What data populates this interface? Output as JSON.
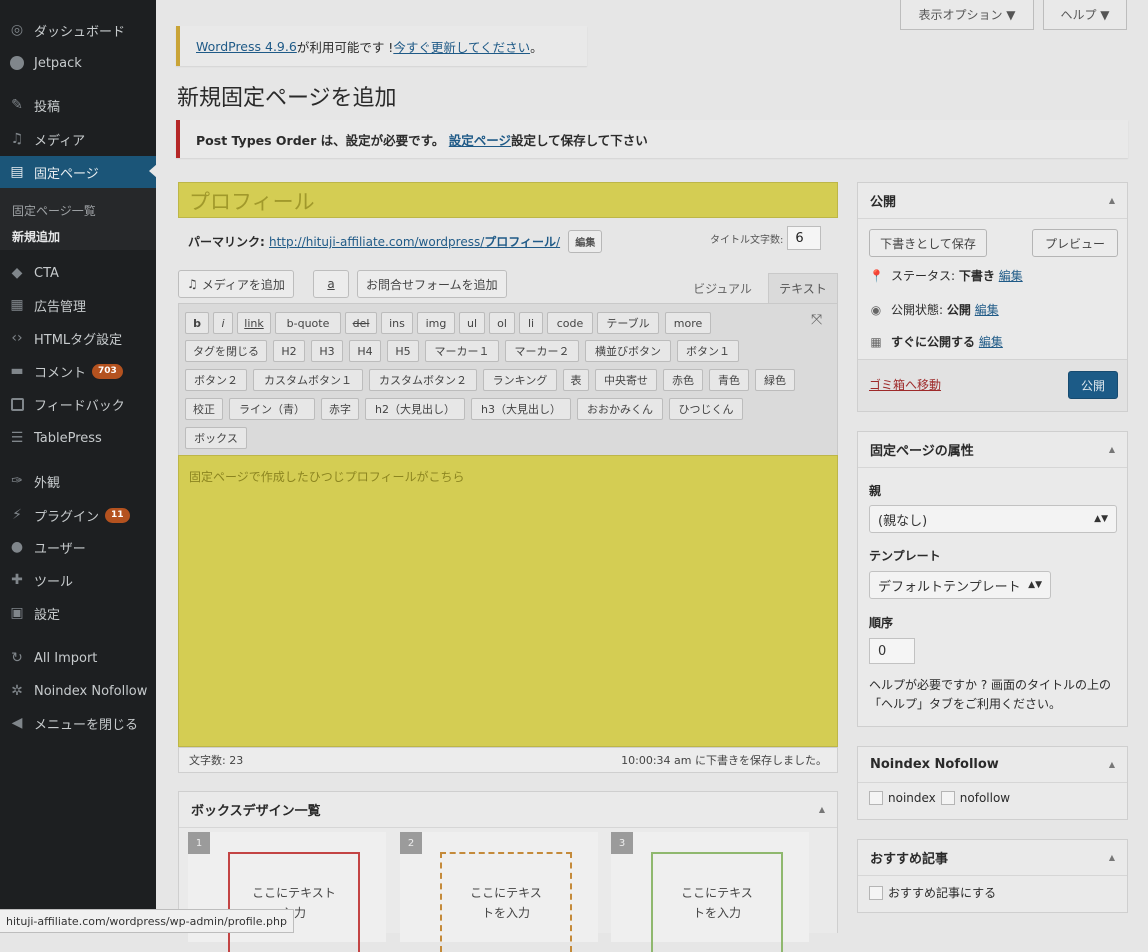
{
  "sidebar": {
    "items": [
      {
        "label": "ダッシュボード",
        "icon": "dashboard-icon"
      },
      {
        "label": "Jetpack",
        "icon": "jetpack-icon"
      },
      {
        "label": "投稿",
        "icon": "posts-icon"
      },
      {
        "label": "メディア",
        "icon": "media-icon"
      },
      {
        "label": "固定ページ",
        "icon": "pages-icon"
      },
      {
        "label": "CTA",
        "icon": "cta-icon"
      },
      {
        "label": "広告管理",
        "icon": "ads-icon"
      },
      {
        "label": "HTMLタグ設定",
        "icon": "code-icon"
      },
      {
        "label": "コメント",
        "icon": "comments-icon",
        "badge": "703"
      },
      {
        "label": "フィードバック",
        "icon": "feedback-icon"
      },
      {
        "label": "TablePress",
        "icon": "table-icon"
      },
      {
        "label": "外観",
        "icon": "appearance-icon"
      },
      {
        "label": "プラグイン",
        "icon": "plugins-icon",
        "badge": "11"
      },
      {
        "label": "ユーザー",
        "icon": "users-icon"
      },
      {
        "label": "ツール",
        "icon": "tools-icon"
      },
      {
        "label": "設定",
        "icon": "settings-icon"
      },
      {
        "label": "All Import",
        "icon": "import-icon"
      },
      {
        "label": "Noindex Nofollow",
        "icon": "gear-icon"
      },
      {
        "label": "メニューを閉じる",
        "icon": "collapse-icon"
      }
    ],
    "submenu": {
      "all_pages": "固定ページ一覧",
      "add_new": "新規追加"
    }
  },
  "screen_options": {
    "display": "表示オプション ▼",
    "help": "ヘルプ ▼"
  },
  "update_notice": {
    "link": "WordPress 4.9.6",
    "text": " が利用可能です ! ",
    "update_link": "今すぐ更新してください",
    "end": "。"
  },
  "page_title": "新規固定ページを追加",
  "pto_notice": {
    "text": "Post Types Order は、設定が必要です。",
    "link": "設定ページ",
    "after": " 設定して保存して下さい"
  },
  "editor": {
    "title_value": "プロフィール",
    "permalink_label": "パーマリンク: ",
    "permalink_url": "http://hituji-affiliate.com/wordpress/",
    "permalink_slug": "プロフィール",
    "permalink_slash": "/",
    "edit_button": "編集",
    "title_count_label": "タイトル文字数:",
    "title_count": "6",
    "media_button": "メディアを追加",
    "amazon_button": "a",
    "form_button": "お問合せフォームを追加",
    "tab_visual": "ビジュアル",
    "tab_text": "テキスト",
    "quicktags": {
      "row1": [
        "b",
        "i",
        "link",
        "b-quote",
        "del",
        "ins",
        "img",
        "ul",
        "ol",
        "li",
        "code",
        "テーブル",
        "more"
      ],
      "row2": [
        "タグを閉じる",
        "H2",
        "H3",
        "H4",
        "H5",
        "マーカー１",
        "マーカー２",
        "横並びボタン",
        "ボタン１"
      ],
      "row3": [
        "ボタン２",
        "カスタムボタン１",
        "カスタムボタン２",
        "ランキング",
        "表",
        "中央寄せ",
        "赤色",
        "青色",
        "緑色"
      ],
      "row4": [
        "校正",
        "ライン（青）",
        "赤字",
        "h2（大見出し）",
        "h3（大見出し）",
        "おおかみくん",
        "ひつじくん"
      ],
      "row5": [
        "ボックス"
      ]
    },
    "content": "固定ページで作成したひつじプロフィールがこちら",
    "word_count": "文字数: 23",
    "save_status": "10:00:34 am に下書きを保存しました。"
  },
  "box_design": {
    "title": "ボックスデザイン一覧",
    "cards": [
      {
        "num": "1",
        "text": "ここにテキスト\n入力",
        "border_color": "#c34444"
      },
      {
        "num": "2",
        "text": "ここにテキス\nトを入力",
        "border_color": "#c48a3a"
      },
      {
        "num": "3",
        "text": "ここにテキス\nトを入力",
        "border_color": "#8fb86e"
      }
    ]
  },
  "publish_box": {
    "title": "公開",
    "save_draft": "下書きとして保存",
    "preview": "プレビュー",
    "status_label": "ステータス: ",
    "status_value": "下書き",
    "visibility_label": "公開状態: ",
    "visibility_value": "公開",
    "schedule_value": "すぐに公開する",
    "edit": "編集",
    "trash": "ゴミ箱へ移動",
    "publish": "公開"
  },
  "attributes_box": {
    "title": "固定ページの属性",
    "parent_label": "親",
    "parent_value": "(親なし)",
    "template_label": "テンプレート",
    "template_value": "デフォルトテンプレート",
    "order_label": "順序",
    "order_value": "0",
    "help_text": "ヘルプが必要ですか ? 画面のタイトルの上の「ヘルプ」タブをご利用ください。"
  },
  "noindex_box": {
    "title": "Noindex Nofollow",
    "noindex": "noindex",
    "nofollow": "nofollow"
  },
  "recommend_box": {
    "title": "おすすめ記事",
    "checkbox": "おすすめ記事にする"
  },
  "status_url": "hituji-affiliate.com/wordpress/wp-admin/profile.php",
  "colors": {
    "highlight": "#d4cd53",
    "sidebar_bg": "#1d1f21",
    "primary": "#1c5b87",
    "badge": "#b4521f"
  }
}
